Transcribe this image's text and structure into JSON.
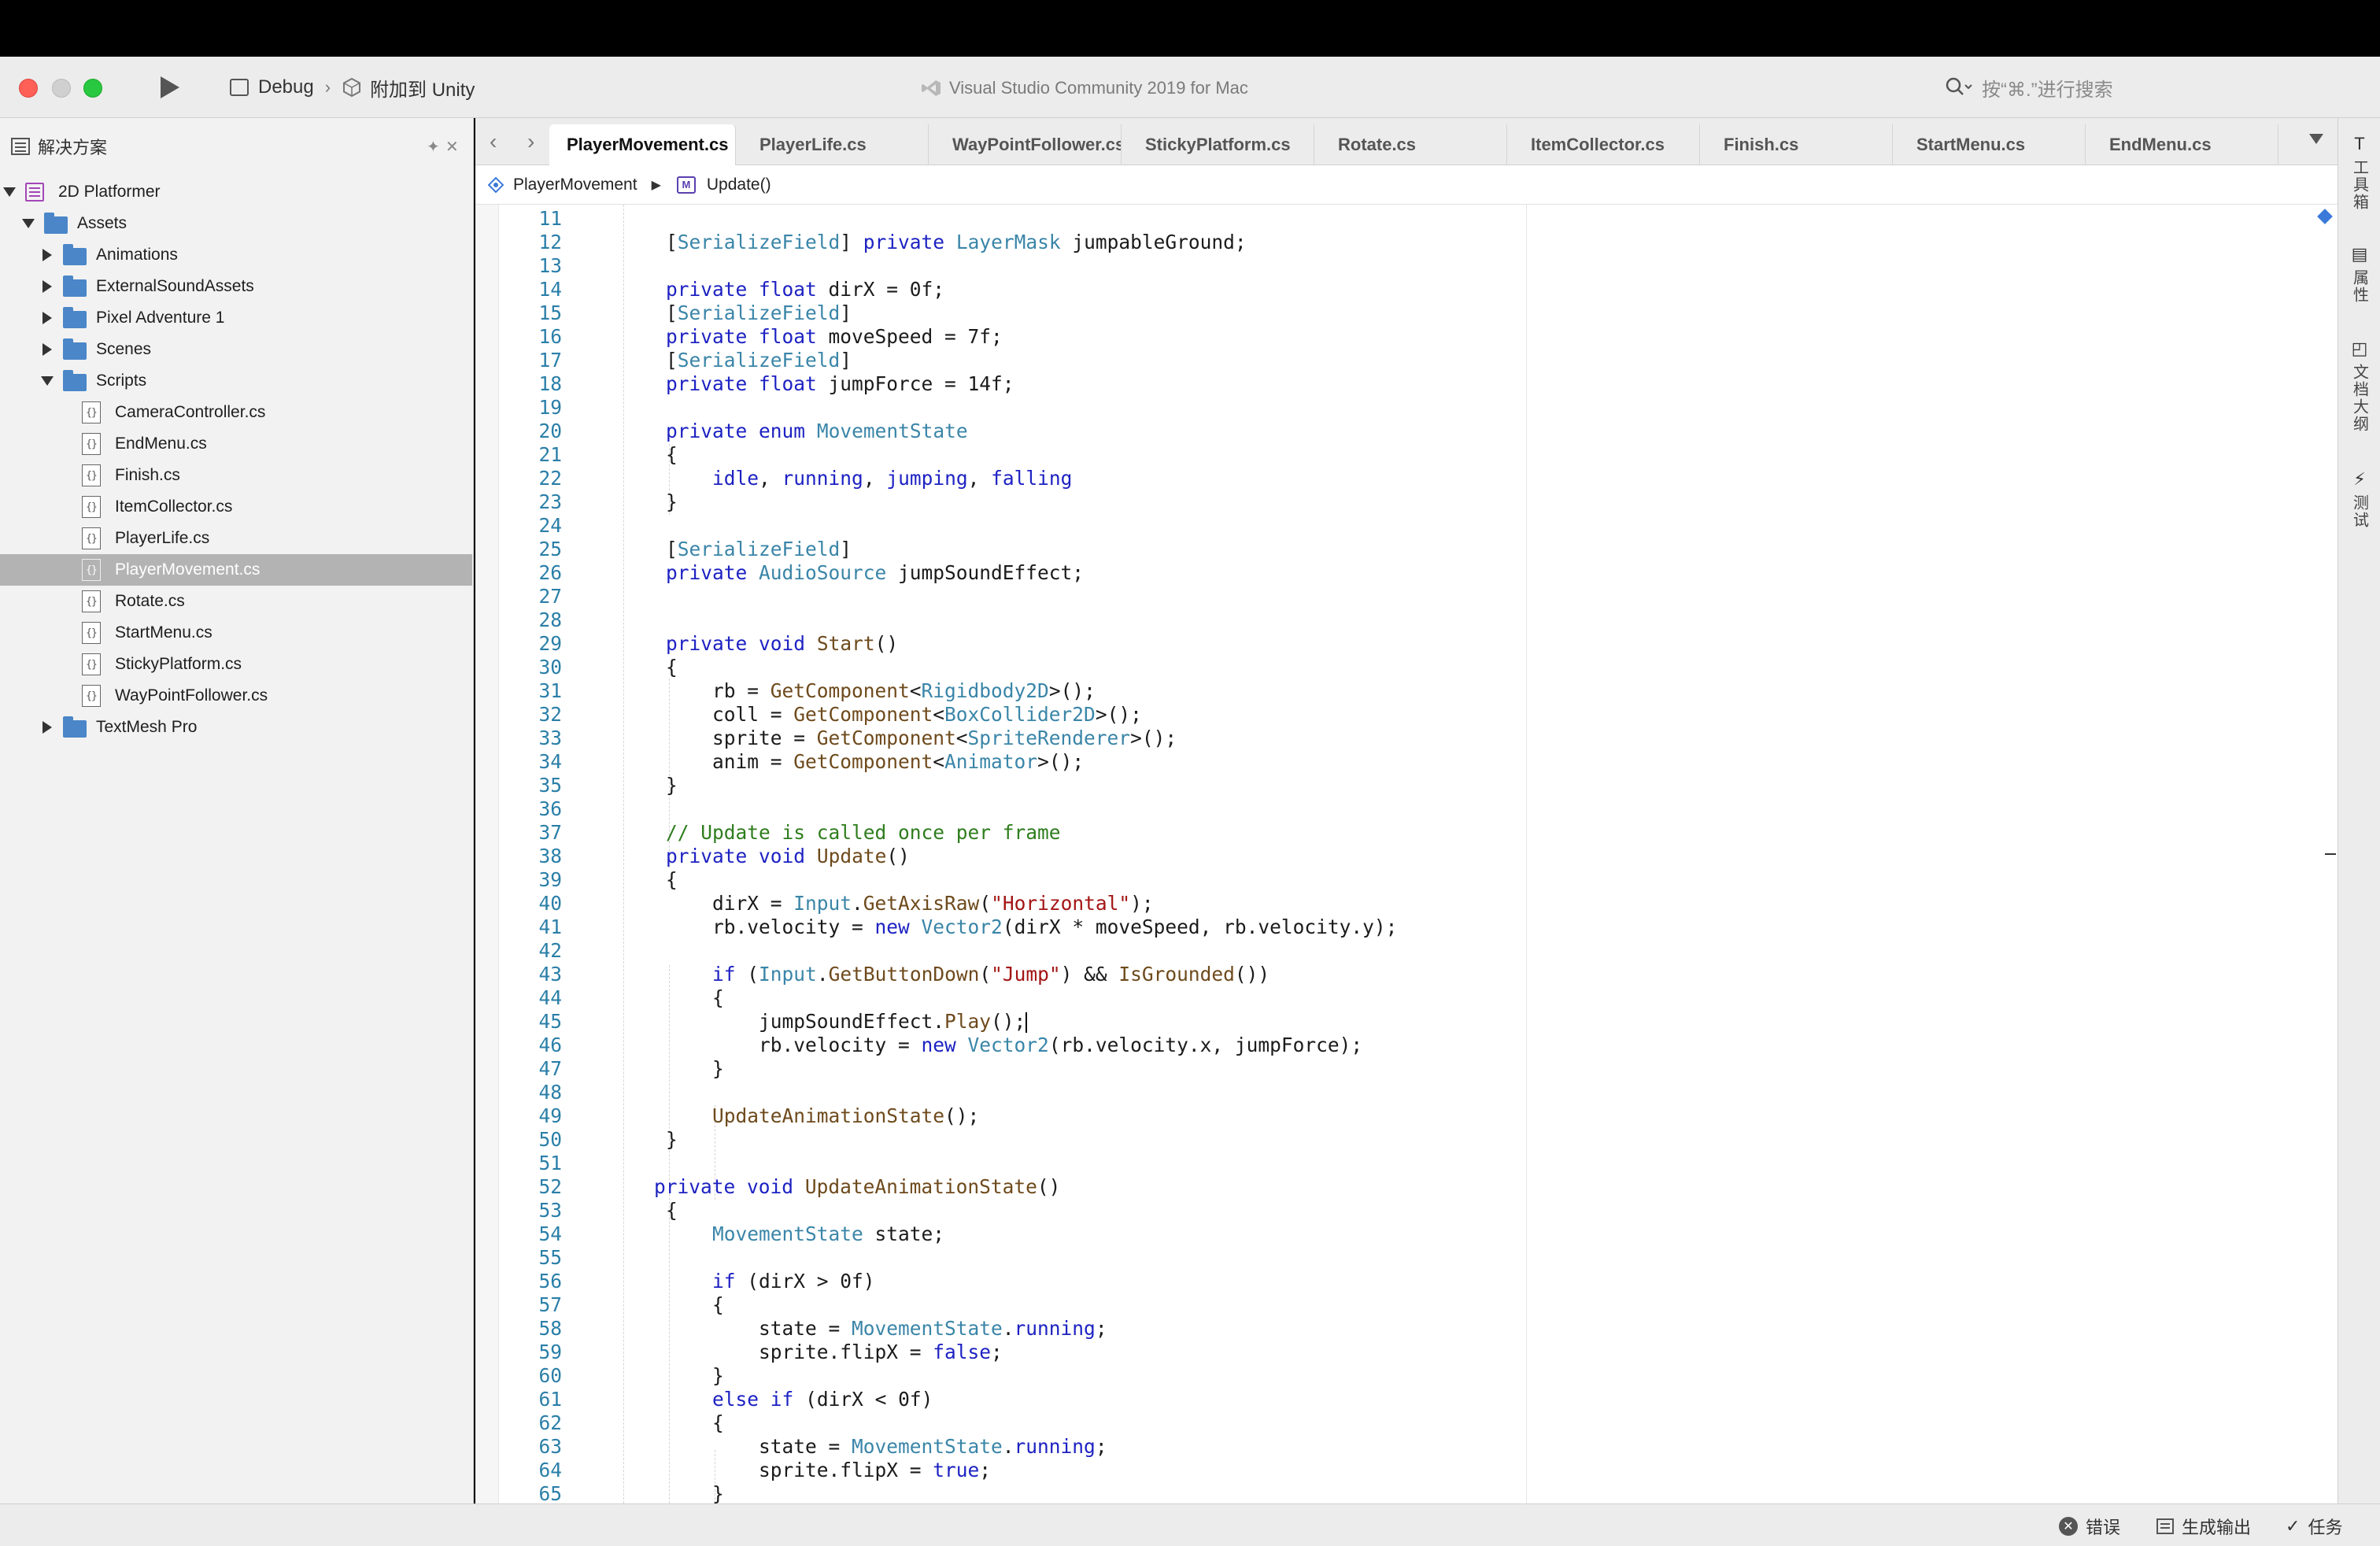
{
  "titlebar": {
    "config_label": "Debug",
    "target_label": "附加到 Unity",
    "window_title": "Visual Studio Community 2019 for Mac",
    "search_placeholder": "按“⌘.”进行搜索"
  },
  "solution_pad": {
    "title": "解决方案",
    "items": [
      {
        "label": "2D Platformer",
        "kind": "project",
        "depth": 0,
        "expander": "open"
      },
      {
        "label": "Assets",
        "kind": "folder",
        "depth": 1,
        "expander": "open"
      },
      {
        "label": "Animations",
        "kind": "folder",
        "depth": 2,
        "expander": "closed"
      },
      {
        "label": "ExternalSoundAssets",
        "kind": "folder",
        "depth": 2,
        "expander": "closed"
      },
      {
        "label": "Pixel Adventure 1",
        "kind": "folder",
        "depth": 2,
        "expander": "closed"
      },
      {
        "label": "Scenes",
        "kind": "folder",
        "depth": 2,
        "expander": "closed"
      },
      {
        "label": "Scripts",
        "kind": "folder",
        "depth": 2,
        "expander": "open"
      },
      {
        "label": "CameraController.cs",
        "kind": "file",
        "depth": 3
      },
      {
        "label": "EndMenu.cs",
        "kind": "file",
        "depth": 3
      },
      {
        "label": "Finish.cs",
        "kind": "file",
        "depth": 3
      },
      {
        "label": "ItemCollector.cs",
        "kind": "file",
        "depth": 3
      },
      {
        "label": "PlayerLife.cs",
        "kind": "file",
        "depth": 3
      },
      {
        "label": "PlayerMovement.cs",
        "kind": "file",
        "depth": 3,
        "selected": true
      },
      {
        "label": "Rotate.cs",
        "kind": "file",
        "depth": 3
      },
      {
        "label": "StartMenu.cs",
        "kind": "file",
        "depth": 3
      },
      {
        "label": "StickyPlatform.cs",
        "kind": "file",
        "depth": 3
      },
      {
        "label": "WayPointFollower.cs",
        "kind": "file",
        "depth": 3
      },
      {
        "label": "TextMesh Pro",
        "kind": "folder",
        "depth": 2,
        "expander": "closed"
      }
    ]
  },
  "tabs": [
    {
      "label": "PlayerMovement.cs",
      "active": true
    },
    {
      "label": "PlayerLife.cs"
    },
    {
      "label": "WayPointFollower.cs"
    },
    {
      "label": "StickyPlatform.cs"
    },
    {
      "label": "Rotate.cs"
    },
    {
      "label": "ItemCollector.cs"
    },
    {
      "label": "Finish.cs"
    },
    {
      "label": "StartMenu.cs"
    },
    {
      "label": "EndMenu.cs"
    }
  ],
  "breadcrumb": {
    "class_name": "PlayerMovement",
    "method_name": "Update()"
  },
  "code": {
    "lines": [
      {
        "n": "11",
        "html": ""
      },
      {
        "n": "12",
        "html": "[<span class='ty'>SerializeField</span>] <span class='k'>private</span> <span class='ty'>LayerMask</span> jumpableGround;"
      },
      {
        "n": "13",
        "html": ""
      },
      {
        "n": "14",
        "html": "<span class='k'>private</span> <span class='k'>float</span> dirX = 0f;"
      },
      {
        "n": "15",
        "html": "[<span class='ty'>SerializeField</span>]"
      },
      {
        "n": "16",
        "html": "<span class='k'>private</span> <span class='k'>float</span> moveSpeed = 7f;"
      },
      {
        "n": "17",
        "html": "[<span class='ty'>SerializeField</span>]"
      },
      {
        "n": "18",
        "html": "<span class='k'>private</span> <span class='k'>float</span> jumpForce = 14f;"
      },
      {
        "n": "19",
        "html": ""
      },
      {
        "n": "20",
        "html": "<span class='k'>private</span> <span class='k'>enum</span> <span class='ty'>MovementState</span>"
      },
      {
        "n": "21",
        "html": "{"
      },
      {
        "n": "22",
        "html": "    <span class='k'>idle</span>, <span class='k'>running</span>, <span class='k'>jumping</span>, <span class='k'>falling</span>"
      },
      {
        "n": "23",
        "html": "}"
      },
      {
        "n": "24",
        "html": ""
      },
      {
        "n": "25",
        "html": "[<span class='ty'>SerializeField</span>]"
      },
      {
        "n": "26",
        "html": "<span class='k'>private</span> <span class='ty'>AudioSource</span> jumpSoundEffect;"
      },
      {
        "n": "27",
        "html": ""
      },
      {
        "n": "28",
        "html": ""
      },
      {
        "n": "29",
        "html": "<span class='k'>private</span> <span class='k'>void</span> <span class='fn'>Start</span>()"
      },
      {
        "n": "30",
        "html": "{"
      },
      {
        "n": "31",
        "html": "    rb = <span class='fn'>GetComponent</span>&lt;<span class='ty'>Rigidbody2D</span>&gt;();"
      },
      {
        "n": "32",
        "html": "    coll = <span class='fn'>GetComponent</span>&lt;<span class='ty'>BoxCollider2D</span>&gt;();"
      },
      {
        "n": "33",
        "html": "    sprite = <span class='fn'>GetComponent</span>&lt;<span class='ty'>SpriteRenderer</span>&gt;();"
      },
      {
        "n": "34",
        "html": "    anim = <span class='fn'>GetComponent</span>&lt;<span class='ty'>Animator</span>&gt;();"
      },
      {
        "n": "35",
        "html": "}"
      },
      {
        "n": "36",
        "html": ""
      },
      {
        "n": "37",
        "html": "<span class='c'>// Update is called once per frame</span>"
      },
      {
        "n": "38",
        "html": "<span class='k'>private</span> <span class='k'>void</span> <span class='fn'>Update</span>()"
      },
      {
        "n": "39",
        "html": "{"
      },
      {
        "n": "40",
        "html": "    dirX = <span class='ty'>Input</span>.<span class='fn'>GetAxisRaw</span>(<span class='s'>\"Horizontal\"</span>);"
      },
      {
        "n": "41",
        "html": "    rb.velocity = <span class='k'>new</span> <span class='ty'>Vector2</span>(dirX * moveSpeed, rb.velocity.y);"
      },
      {
        "n": "42",
        "html": ""
      },
      {
        "n": "43",
        "html": "    <span class='k'>if</span> (<span class='ty'>Input</span>.<span class='fn'>GetButtonDown</span>(<span class='s'>\"Jump\"</span>) &amp;&amp; <span class='fn'>IsGrounded</span>())"
      },
      {
        "n": "44",
        "html": "    {"
      },
      {
        "n": "45",
        "html": "        jumpSoundEffect.<span class='fn'>Play</span>();<span class='caret'></span>"
      },
      {
        "n": "46",
        "html": "        rb.velocity = <span class='k'>new</span> <span class='ty'>Vector2</span>(rb.velocity.x, jumpForce);"
      },
      {
        "n": "47",
        "html": "    }"
      },
      {
        "n": "48",
        "html": ""
      },
      {
        "n": "49",
        "html": "    <span class='fn'>UpdateAnimationState</span>();"
      },
      {
        "n": "50",
        "html": "}"
      },
      {
        "n": "51",
        "html": ""
      },
      {
        "n": "52",
        "html": "<span class='k'>private</span> <span class='k'>void</span> <span class='fn'>UpdateAnimationState</span>()",
        "outdent": true
      },
      {
        "n": "53",
        "html": "{"
      },
      {
        "n": "54",
        "html": "    <span class='ty'>MovementState</span> state;"
      },
      {
        "n": "55",
        "html": ""
      },
      {
        "n": "56",
        "html": "    <span class='k'>if</span> (dirX &gt; 0f)"
      },
      {
        "n": "57",
        "html": "    {"
      },
      {
        "n": "58",
        "html": "        state = <span class='ty'>MovementState</span>.<span class='k'>running</span>;"
      },
      {
        "n": "59",
        "html": "        sprite.flipX = <span class='k'>false</span>;"
      },
      {
        "n": "60",
        "html": "    }"
      },
      {
        "n": "61",
        "html": "    <span class='k'>else</span> <span class='k'>if</span> (dirX &lt; 0f)"
      },
      {
        "n": "62",
        "html": "    {"
      },
      {
        "n": "63",
        "html": "        state = <span class='ty'>MovementState</span>.<span class='k'>running</span>;"
      },
      {
        "n": "64",
        "html": "        sprite.flipX = <span class='k'>true</span>;"
      },
      {
        "n": "65",
        "html": "    }"
      }
    ]
  },
  "right_dock": [
    {
      "label": "工具箱",
      "icon": "toolbox-icon"
    },
    {
      "label": "属性",
      "icon": "properties-icon"
    },
    {
      "label": "文档大纲",
      "icon": "document-outline-icon"
    },
    {
      "label": "测试",
      "icon": "test-icon"
    }
  ],
  "status": {
    "errors_label": "错误",
    "build_output_label": "生成输出",
    "tasks_label": "任务"
  },
  "colors": {
    "keyword": "#1d22c2",
    "type": "#3a85a8",
    "method": "#6e4a1c",
    "string": "#a31515",
    "comment": "#2e7d1d",
    "line_number": "#2b7fa8",
    "folder": "#4a86c8",
    "selection": "#b3b3b3"
  }
}
